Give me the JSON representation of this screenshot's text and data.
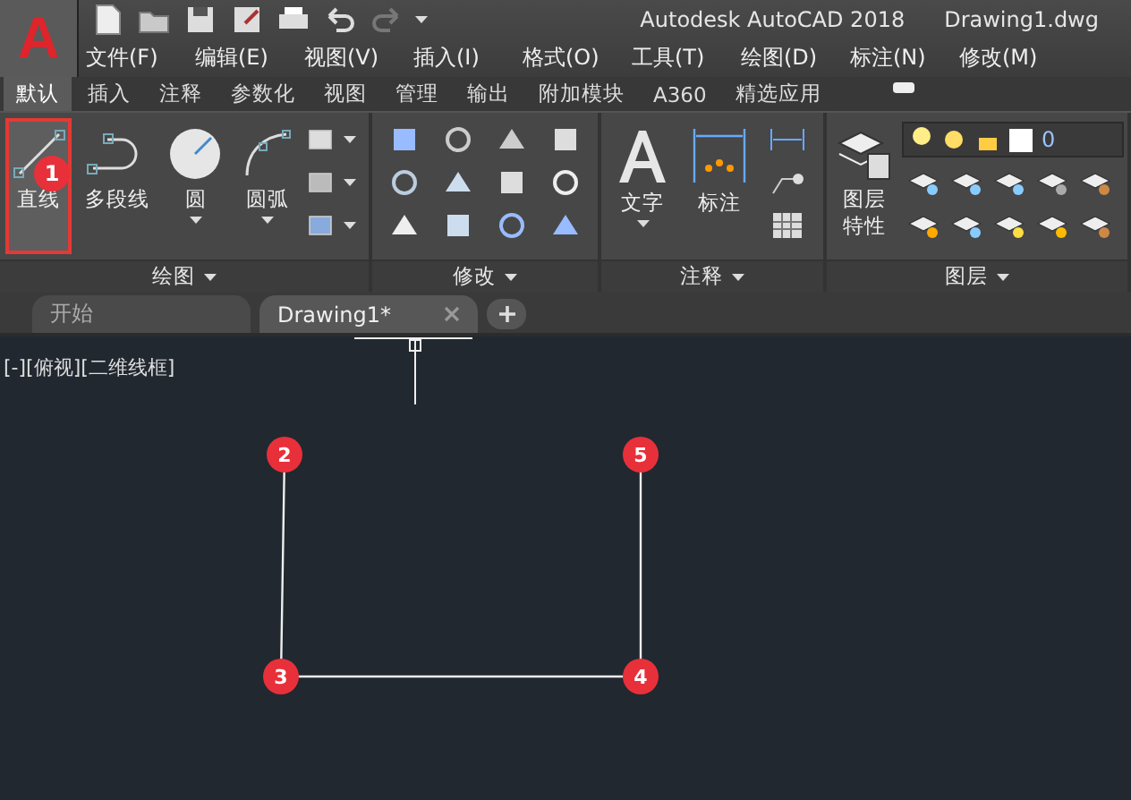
{
  "app_logo": "A",
  "title_bar": {
    "app_title": "Autodesk AutoCAD 2018",
    "file_name": "Drawing1.dwg"
  },
  "menu": [
    "文件(F)",
    "编辑(E)",
    "视图(V)",
    "插入(I)",
    "格式(O)",
    "工具(T)",
    "绘图(D)",
    "标注(N)",
    "修改(M)"
  ],
  "ribbon_tabs": [
    {
      "label": "默认",
      "selected": true
    },
    {
      "label": "插入",
      "selected": false
    },
    {
      "label": "注释",
      "selected": false
    },
    {
      "label": "参数化",
      "selected": false
    },
    {
      "label": "视图",
      "selected": false
    },
    {
      "label": "管理",
      "selected": false
    },
    {
      "label": "输出",
      "selected": false
    },
    {
      "label": "附加模块",
      "selected": false
    },
    {
      "label": "A360",
      "selected": false
    },
    {
      "label": "精选应用",
      "selected": false
    }
  ],
  "panels": [
    {
      "kind": "draw",
      "title": "绘图",
      "tools": [
        {
          "label": "直线",
          "highlighted": true,
          "marker": "1",
          "dropdown": false
        },
        {
          "label": "多段线",
          "highlighted": false,
          "dropdown": false
        },
        {
          "label": "圆",
          "highlighted": false,
          "dropdown": true
        },
        {
          "label": "圆弧",
          "highlighted": false,
          "dropdown": true
        }
      ]
    },
    {
      "kind": "modify",
      "title": "修改"
    },
    {
      "kind": "annotate",
      "title": "注释",
      "tools": [
        {
          "label": "文字",
          "highlighted": false,
          "dropdown": true
        },
        {
          "label": "标注",
          "highlighted": false,
          "dropdown": false
        }
      ]
    },
    {
      "kind": "layers",
      "title": "图层",
      "tools": [
        {
          "label": "图层特性",
          "highlighted": false,
          "dropdown": false
        }
      ],
      "layer": "0"
    }
  ],
  "doc_tabs": [
    {
      "label": "开始",
      "selected": false,
      "closable": false
    },
    {
      "label": "Drawing1*",
      "selected": true,
      "closable": true
    }
  ],
  "viewport_label": "[-][俯视][二维线框]",
  "points": [
    {
      "label": "2"
    },
    {
      "label": "5"
    },
    {
      "label": "3"
    },
    {
      "label": "4"
    }
  ]
}
